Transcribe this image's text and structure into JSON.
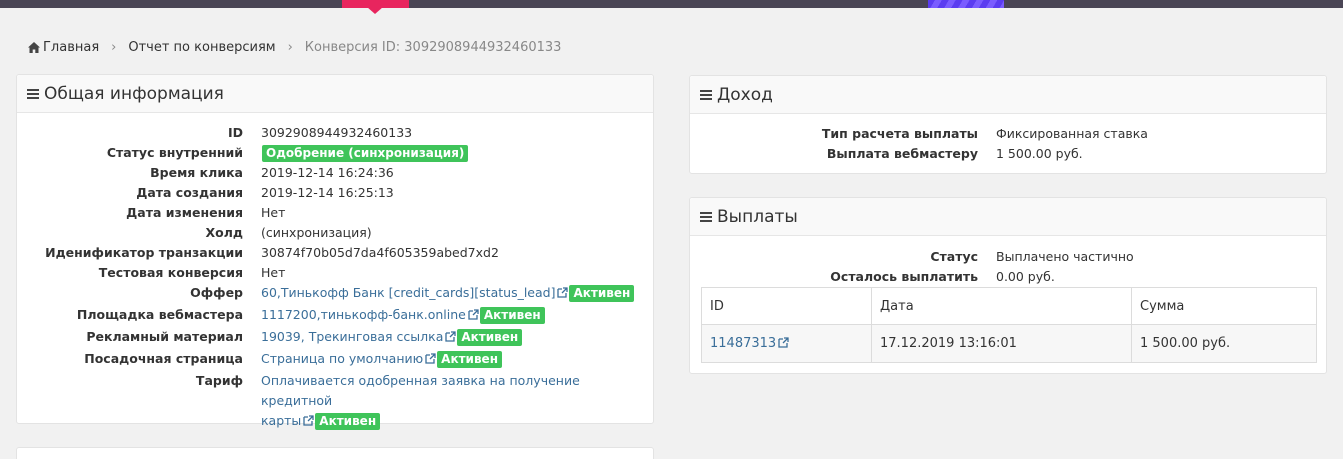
{
  "breadcrumb": {
    "home": "Главная",
    "report": "Отчет по конверсиям",
    "current": "Конверсия ID: 3092908944932460133"
  },
  "general": {
    "title": "Общая информация",
    "rows": {
      "id": {
        "label": "ID",
        "value": "3092908944932460133"
      },
      "status_internal": {
        "label": "Статус внутренний",
        "badge": "Одобрение (синхронизация)"
      },
      "click_time": {
        "label": "Время клика",
        "value": "2019-12-14 16:24:36"
      },
      "created": {
        "label": "Дата создания",
        "value": "2019-12-14 16:25:13"
      },
      "modified": {
        "label": "Дата изменения",
        "value": "Нет"
      },
      "hold": {
        "label": "Холд",
        "value": "(синхронизация)"
      },
      "transaction": {
        "label": "Иденификатор транзакции",
        "value": "30874f70b05d7da4f605359abed7xd2"
      },
      "test": {
        "label": "Тестовая конверсия",
        "value": "Нет"
      },
      "offer": {
        "label": "Оффер",
        "link": "60,Тинькофф Банк [credit_cards][status_lead]",
        "badge": "Активен"
      },
      "platform": {
        "label": "Площадка вебмастера",
        "link": "1117200,тинькофф-банк.online",
        "badge": "Активен"
      },
      "ad": {
        "label": "Рекламный материал",
        "link": "19039, Трекинговая ссылка",
        "badge": "Активен"
      },
      "landing": {
        "label": "Посадочная страница",
        "link": "Страница по умолчанию",
        "badge": "Активен"
      },
      "tariff": {
        "label": "Тариф",
        "link_line1": "Оплачивается одобренная заявка на получение кредитной",
        "link_line2": "карты",
        "badge": "Активен"
      }
    }
  },
  "income": {
    "title": "Доход",
    "rows": {
      "calc_type": {
        "label": "Тип расчета выплаты",
        "value": "Фиксированная ставка"
      },
      "payout": {
        "label": "Выплата вебмастеру",
        "value": "1 500.00 руб."
      }
    }
  },
  "payments": {
    "title": "Выплаты",
    "rows": {
      "status": {
        "label": "Статус",
        "value": "Выплачено частично"
      },
      "remaining": {
        "label": "Осталось выплатить",
        "value": "0.00 руб."
      }
    },
    "table": {
      "headers": [
        "ID",
        "Дата",
        "Сумма"
      ],
      "rows": [
        {
          "id": "11487313",
          "date": "17.12.2019 13:16:01",
          "amount": "1 500.00 руб."
        }
      ]
    }
  },
  "colors": {
    "accent_pink": "#e8255e",
    "badge_green": "#3fc45a",
    "link_blue": "#3a6e99"
  }
}
